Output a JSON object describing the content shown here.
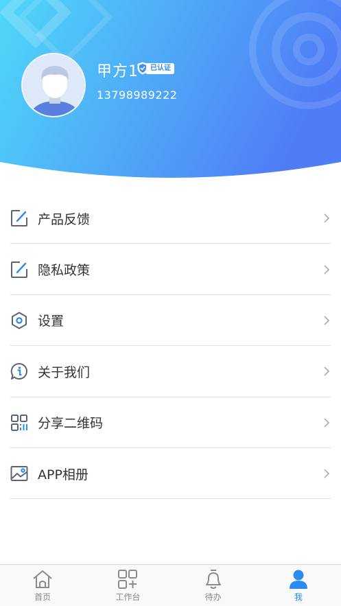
{
  "colors": {
    "header_gradient_start": "#4fd6f7",
    "header_gradient_end": "#4f7ff7",
    "accent": "#2a8bf0",
    "icon_gray": "#5b6470",
    "icon_blue": "#2a8bf0"
  },
  "profile": {
    "name": "甲方1",
    "verified_label": "已认证",
    "phone": "13798989222"
  },
  "menu": {
    "items": [
      {
        "label": "产品反馈",
        "icon": "edit-icon"
      },
      {
        "label": "隐私政策",
        "icon": "edit-icon"
      },
      {
        "label": "设置",
        "icon": "settings-hexagon-icon"
      },
      {
        "label": "关于我们",
        "icon": "info-bubble-icon"
      },
      {
        "label": "分享二维码",
        "icon": "qr-code-icon"
      },
      {
        "label": "APP相册",
        "icon": "image-icon"
      }
    ]
  },
  "tabbar": {
    "tabs": [
      {
        "label": "首页",
        "icon": "home-icon",
        "active": false
      },
      {
        "label": "工作台",
        "icon": "grid-icon",
        "active": false
      },
      {
        "label": "待办",
        "icon": "bell-icon",
        "active": false
      },
      {
        "label": "我",
        "icon": "person-icon",
        "active": true
      }
    ]
  }
}
